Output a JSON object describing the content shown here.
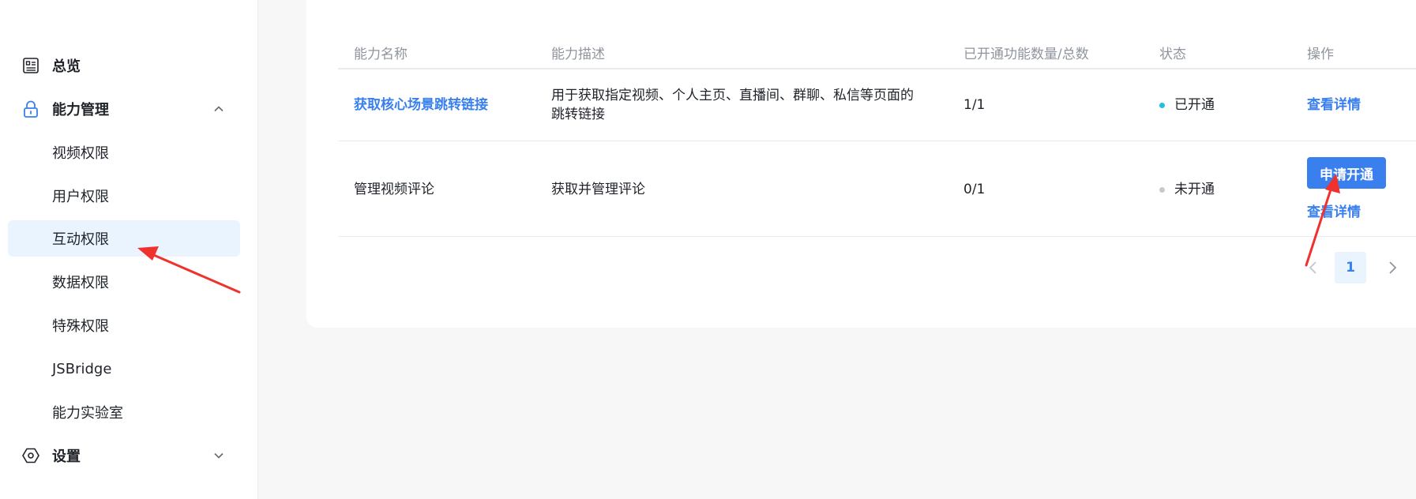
{
  "sidebar": {
    "items": [
      {
        "label": "总览",
        "icon": "overview-icon"
      },
      {
        "label": "能力管理",
        "icon": "lock-icon",
        "expanded": true
      },
      {
        "label": "视频权限"
      },
      {
        "label": "用户权限"
      },
      {
        "label": "互动权限",
        "active": true
      },
      {
        "label": "数据权限"
      },
      {
        "label": "特殊权限"
      },
      {
        "label": "JSBridge"
      },
      {
        "label": "能力实验室"
      },
      {
        "label": "设置",
        "icon": "settings-hexagon-icon",
        "expanded": false
      }
    ]
  },
  "table": {
    "headers": {
      "name": "能力名称",
      "desc": "能力描述",
      "count": "已开通功能数量/总数",
      "status": "状态",
      "action": "操作"
    },
    "rows": [
      {
        "name": "获取核心场景跳转链接",
        "desc_line1": "用于获取指定视频、个人主页、直播间、群聊、私信等页面的",
        "desc_line2": "跳转链接",
        "count": "1/1",
        "status": "已开通",
        "status_color": "#1fc1dc",
        "action_detail": "查看详情"
      },
      {
        "name": "管理视频评论",
        "desc": "获取并管理评论",
        "count": "0/1",
        "status": "未开通",
        "status_color": "#c7c9cc",
        "action_apply": "申请开通",
        "action_detail": "查看详情"
      }
    ]
  },
  "pagination": {
    "current_page": "1"
  },
  "colors": {
    "accent": "#3a7fee",
    "annotation": "#f0322e"
  }
}
